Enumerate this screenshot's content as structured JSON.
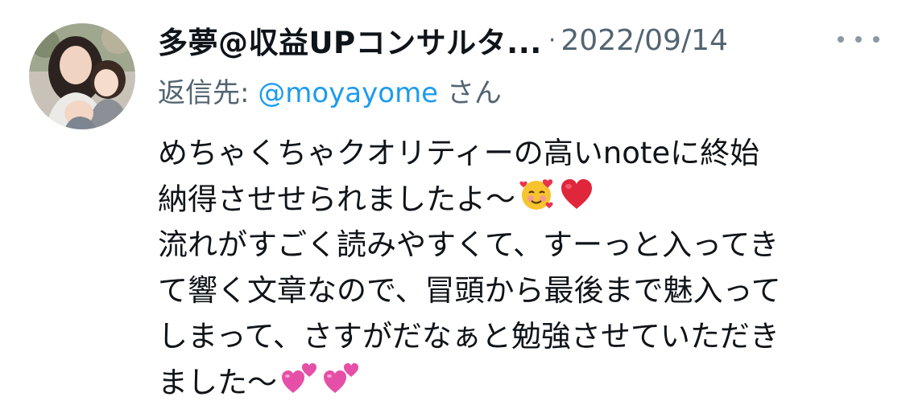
{
  "tweet": {
    "display_name": "多夢@収益UPコンサルタ...",
    "separator": "·",
    "date": "2022/09/14",
    "reply_prefix": "返信先: ",
    "reply_handle": "@moyayome",
    "reply_suffix": " さん",
    "body_lines": [
      "めちゃくちゃクオリティーの高いnoteに終始",
      "納得させせられましたよ〜",
      "流れがすごく読みやすくて、すーっと入ってき",
      "て響く文章なので、冒頭から最後まで魅入って",
      "しまって、さすがだなぁと勉強させていただき",
      "ました〜"
    ],
    "emojis": {
      "line2": [
        "smiling-face-with-hearts",
        "red-heart"
      ],
      "line6": [
        "two-hearts",
        "two-hearts"
      ]
    }
  },
  "colors": {
    "text": "#0f1419",
    "secondary": "#536471",
    "link": "#1d9bf0",
    "more_dots": "#8b98a5"
  },
  "icons": [
    "avatar-photo",
    "more-options-icon",
    "smiling-face-with-hearts-icon",
    "red-heart-icon",
    "two-hearts-icon"
  ]
}
